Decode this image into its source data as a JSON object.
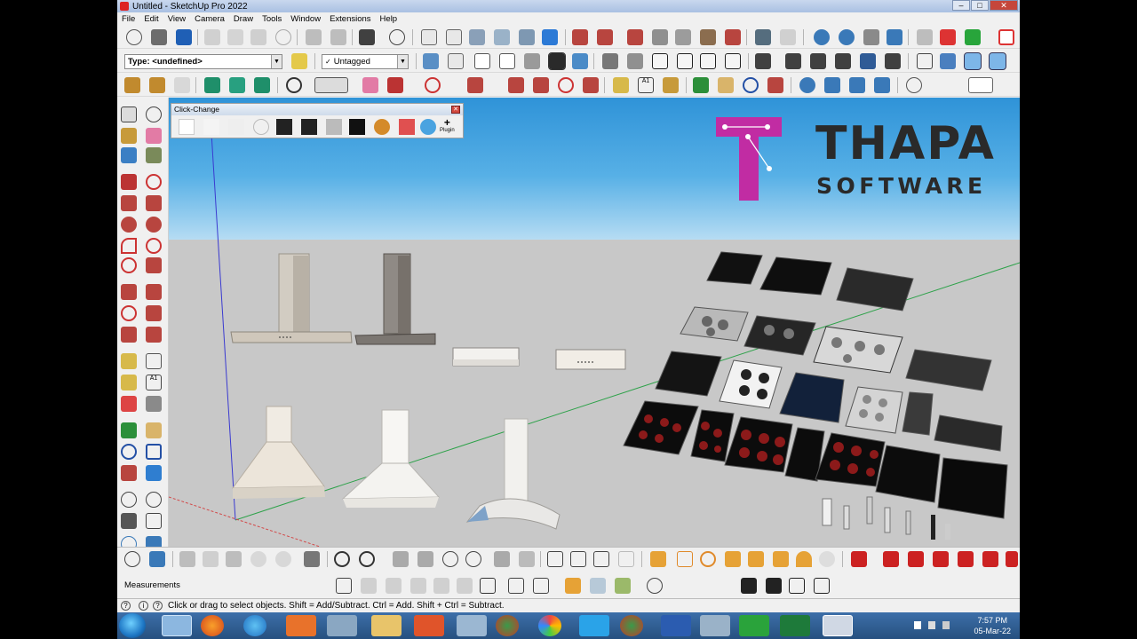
{
  "window": {
    "title": "Untitled - SketchUp Pro 2022"
  },
  "menu": [
    "File",
    "Edit",
    "View",
    "Camera",
    "Draw",
    "Tools",
    "Window",
    "Extensions",
    "Help"
  ],
  "toolbar": {
    "type_select": "Type: <undefined>",
    "tag_select": "Untagged"
  },
  "click_change": {
    "title": "Click-Change",
    "plugin_label": "Plugin"
  },
  "logo": {
    "title": "THAPA",
    "subtitle": "SOFTWARE"
  },
  "measurements_label": "Measurements",
  "status": {
    "text": "Click or drag to select objects. Shift = Add/Subtract. Ctrl = Add. Shift + Ctrl = Subtract."
  },
  "taskbar": {
    "time": "7:57 PM",
    "date": "05-Mar-22"
  },
  "colors": {
    "sky": "#4aa6e2",
    "ground": "#c8c8c8",
    "logo_magenta": "#c12ca3",
    "taskbar": "#2f5b8f"
  }
}
